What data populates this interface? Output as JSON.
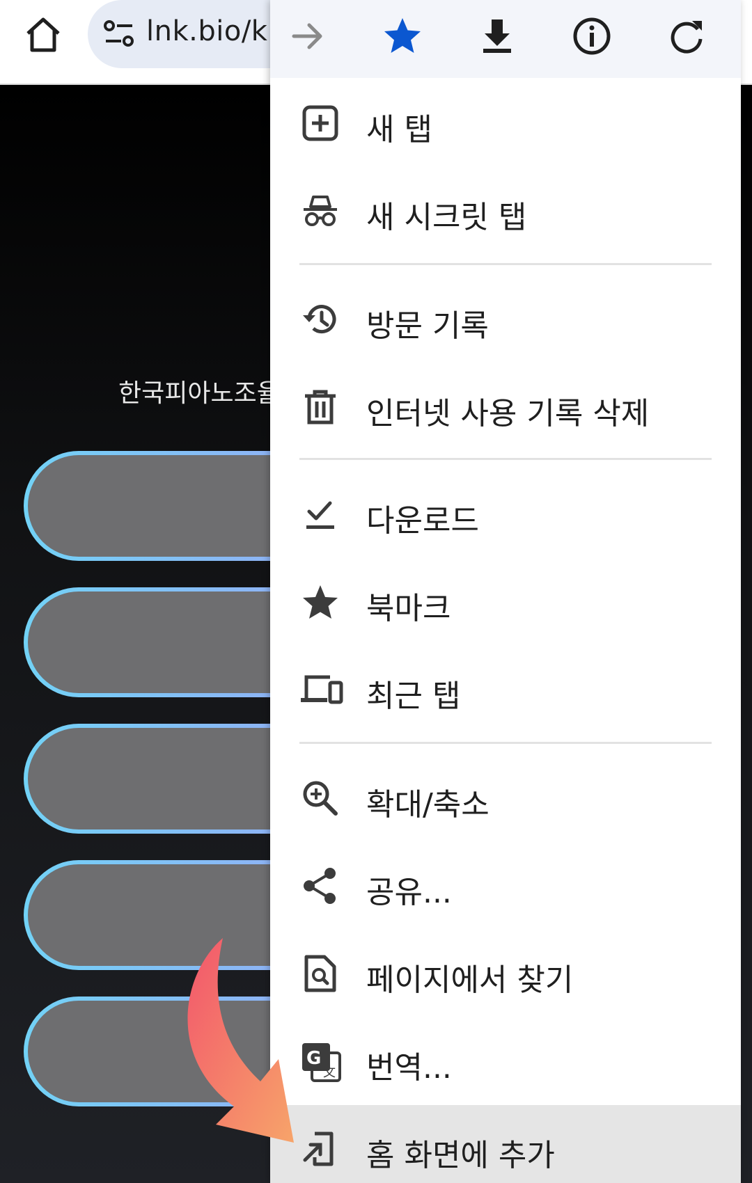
{
  "toolbar": {
    "url_text": "lnk.bio/kp"
  },
  "page": {
    "description": "한국피아노조율"
  },
  "menu": {
    "actions": [
      {
        "name": "forward-arrow-icon"
      },
      {
        "name": "bookmark-star-icon",
        "color": "#0b57d0"
      },
      {
        "name": "download-icon"
      },
      {
        "name": "info-icon"
      },
      {
        "name": "reload-icon"
      }
    ],
    "items": [
      {
        "label": "새 탭",
        "icon": "new-tab-icon"
      },
      {
        "label": "새 시크릿 탭",
        "icon": "incognito-icon"
      },
      {
        "label": "방문 기록",
        "icon": "history-icon"
      },
      {
        "label": "인터넷 사용 기록 삭제",
        "icon": "trash-icon"
      },
      {
        "label": "다운로드",
        "icon": "downloads-check-icon"
      },
      {
        "label": "북마크",
        "icon": "star-icon"
      },
      {
        "label": "최근 탭",
        "icon": "devices-icon"
      },
      {
        "label": "확대/축소",
        "icon": "zoom-in-icon"
      },
      {
        "label": "공유...",
        "icon": "share-icon"
      },
      {
        "label": "페이지에서 찾기",
        "icon": "find-in-page-icon"
      },
      {
        "label": "번역...",
        "icon": "translate-icon"
      },
      {
        "label": "홈 화면에 추가",
        "icon": "add-to-home-icon"
      }
    ]
  },
  "colors": {
    "accent_blue": "#0b57d0",
    "highlight_row": "#e5e5e5",
    "arrow_gradient_start": "#f2566b",
    "arrow_gradient_end": "#f7a46a"
  }
}
